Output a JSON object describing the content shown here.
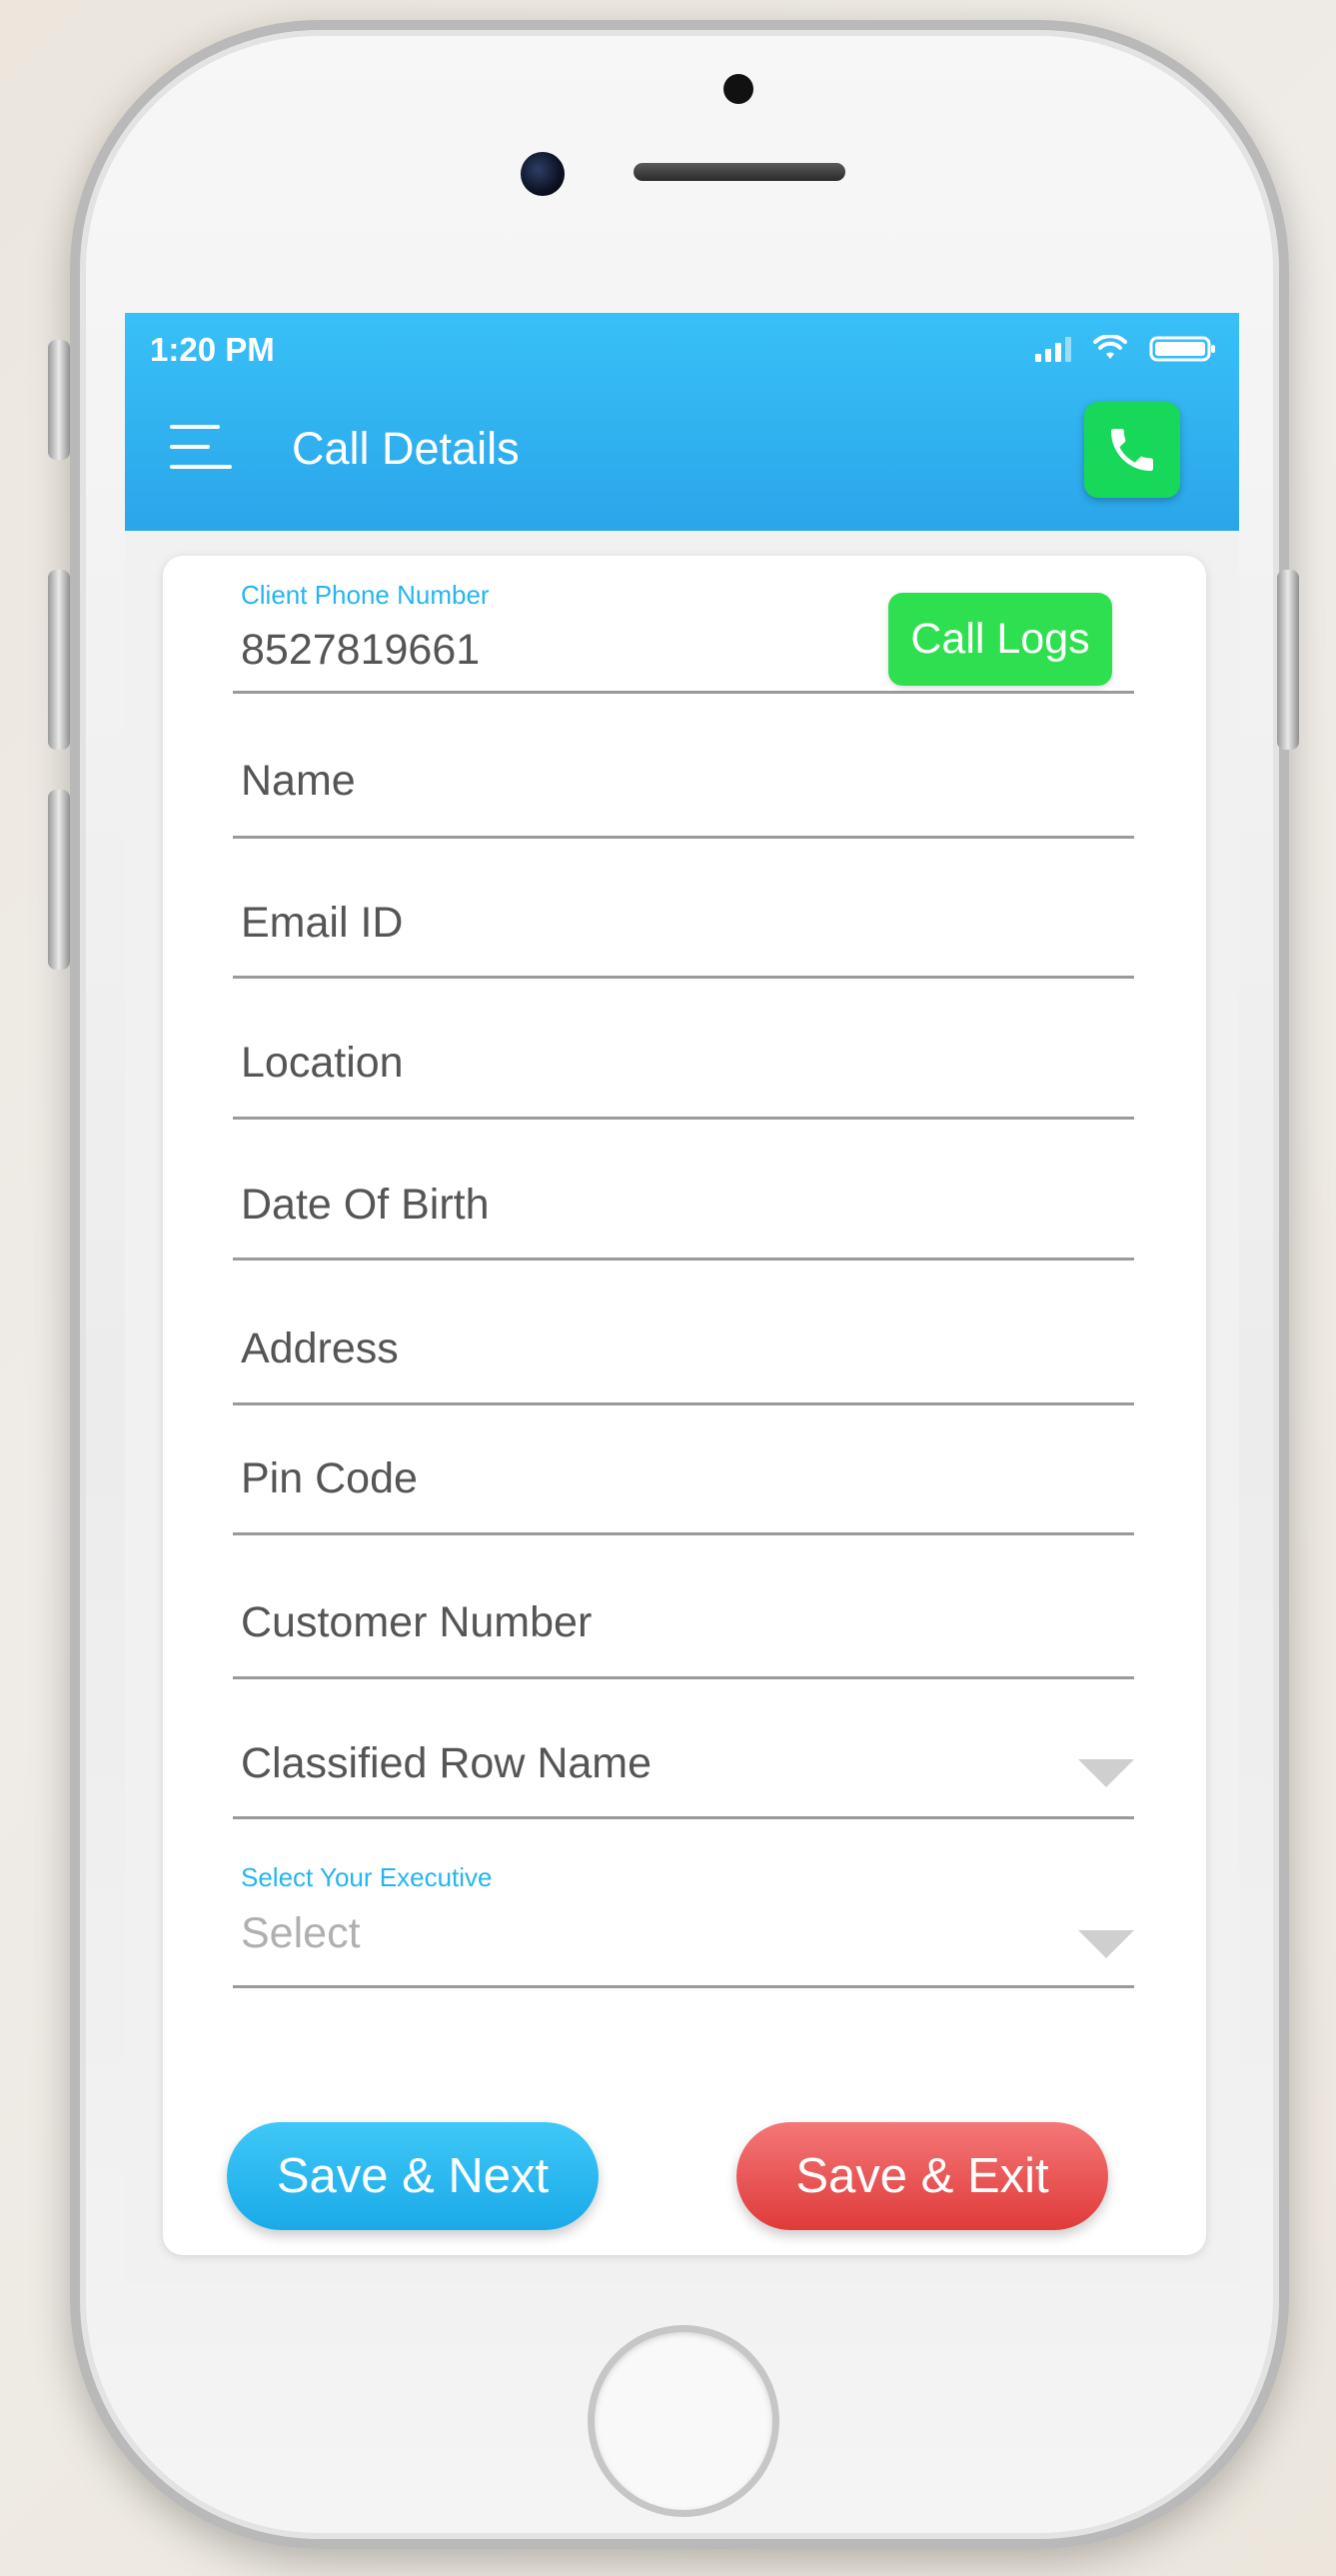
{
  "status_bar": {
    "time": "1:20 PM"
  },
  "header": {
    "title": "Call Details",
    "icons": [
      "menu-icon",
      "phone-icon"
    ]
  },
  "form": {
    "client_phone": {
      "label": "Client Phone Number",
      "value": "8527819661"
    },
    "call_logs_label": "Call Logs",
    "fields": [
      {
        "placeholder": "Name"
      },
      {
        "placeholder": "Email ID"
      },
      {
        "placeholder": "Location"
      },
      {
        "placeholder": "Date Of Birth"
      },
      {
        "placeholder": "Address"
      },
      {
        "placeholder": "Pin Code"
      },
      {
        "placeholder": "Customer Number"
      }
    ],
    "classified_row": {
      "placeholder": "Classified Row Name"
    },
    "executive": {
      "label": "Select Your Executive",
      "value": "Select"
    }
  },
  "actions": {
    "save_next": "Save & Next",
    "save_exit": "Save & Exit"
  },
  "colors": {
    "header": "#2aa6ea",
    "call_button": "#18d85a",
    "call_logs": "#2ee04f",
    "label": "#24b6ee",
    "save_next": "#1aaae8",
    "save_exit": "#e03a3a"
  }
}
